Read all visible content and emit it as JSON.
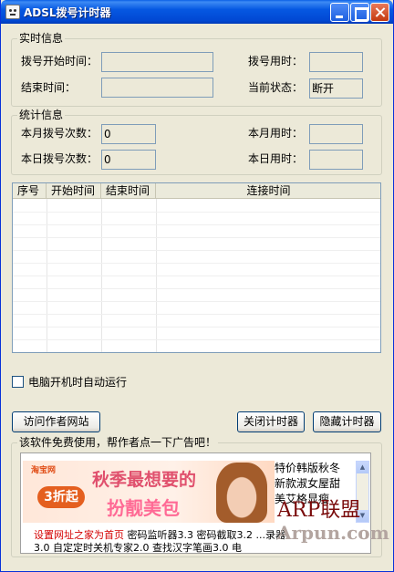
{
  "window": {
    "title": "ADSL拨号计时器"
  },
  "realtime": {
    "legend": "实时信息",
    "dial_start_label": "拨号开始时间：",
    "dial_start_value": "",
    "dial_used_label": "拨号用时：",
    "dial_used_value": "",
    "end_time_label": "结束时间：",
    "end_time_value": "",
    "status_label": "当前状态：",
    "status_value": "断开"
  },
  "stats": {
    "legend": "统计信息",
    "month_count_label": "本月拨号次数：",
    "month_count_value": "0",
    "month_used_label": "本月用时：",
    "month_used_value": "",
    "day_count_label": "本日拨号次数：",
    "day_count_value": "0",
    "day_used_label": "本日用时：",
    "day_used_value": ""
  },
  "table": {
    "columns": [
      "序号",
      "开始时间",
      "结束时间",
      "连接时间"
    ],
    "rows": []
  },
  "autostart": {
    "label": "电脑开机时自动运行",
    "checked": false
  },
  "buttons": {
    "visit_author": "访问作者网站",
    "close_timer": "关闭计时器",
    "hide_timer": "隐藏计时器"
  },
  "ad": {
    "legend": "该软件免费使用，帮作者点一下广告吧！",
    "banner_logo": "淘宝网",
    "banner_badge": "3折起",
    "banner_headline": "秋季最想要的",
    "banner_subline": "扮靓美包",
    "side_text": "特价韩版秋冬新款淑女屋甜美艾格显瘦",
    "link_text": "设置网址之家为首页",
    "other_text": "密码监听器3.3 密码截取3.2 ...录器3.0 自定定时关机专家2.0 查找汉字笔画3.0 电",
    "watermark_line1": "ARP联盟",
    "watermark_line2": "Arpun.com"
  }
}
